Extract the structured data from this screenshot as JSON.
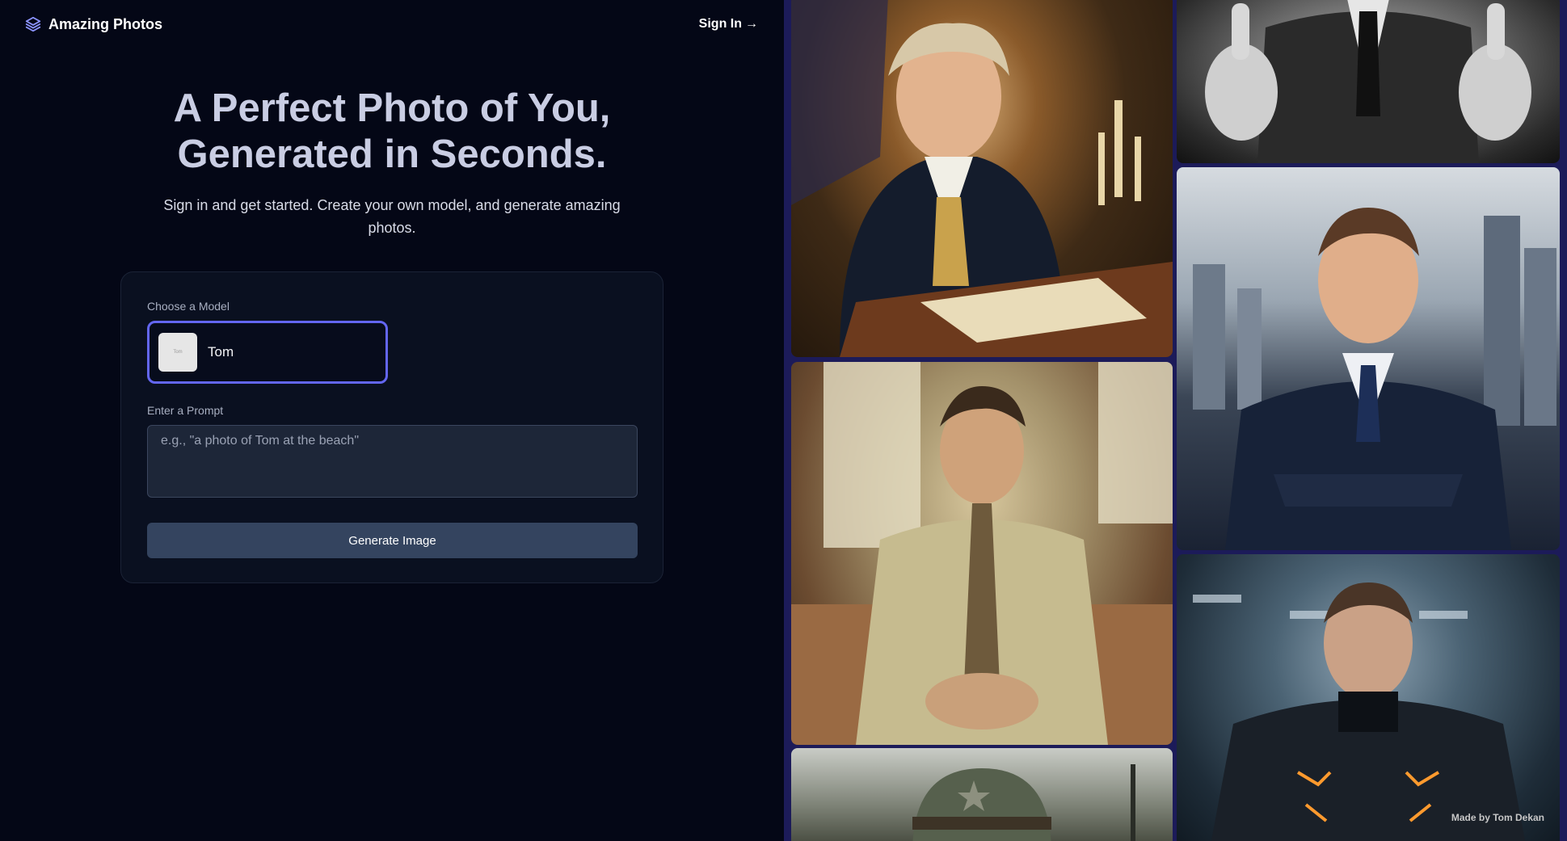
{
  "nav": {
    "brand": "Amazing Photos",
    "signin": "Sign In",
    "signin_arrow": "→"
  },
  "hero": {
    "title_line1": "A Perfect Photo of You,",
    "title_line2": "Generated in Seconds.",
    "subtitle": "Sign in and get started. Create your own model, and generate amazing photos."
  },
  "form": {
    "model_label": "Choose a Model",
    "model_selected": "Tom",
    "model_thumb_text": "Tom",
    "prompt_label": "Enter a Prompt",
    "prompt_placeholder": "e.g., \"a photo of Tom at the beach\"",
    "prompt_value": "",
    "generate_label": "Generate Image"
  },
  "gallery": {
    "credit": "Made by Tom Dekan"
  },
  "colors": {
    "background": "#040716",
    "accent": "#6366f1",
    "button": "#34445f",
    "gallery_bg": "#1c1b59"
  },
  "icons": {
    "brand": "layers-icon",
    "signin": "arrow-right-icon"
  }
}
